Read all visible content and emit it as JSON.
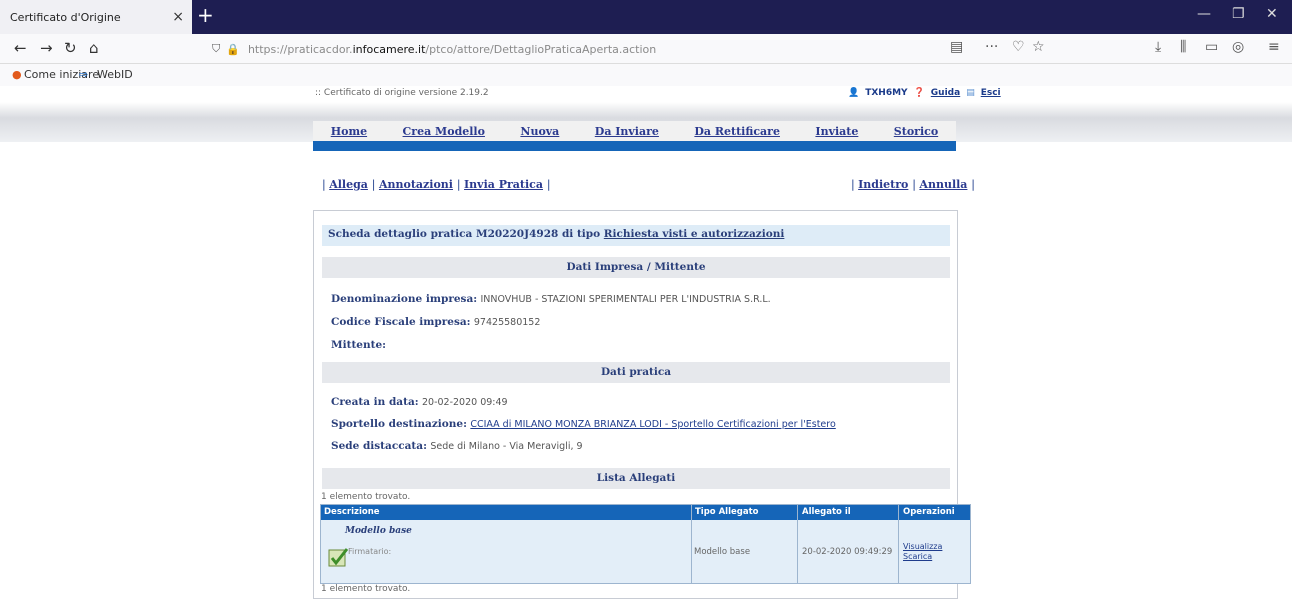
{
  "browser": {
    "tab_title": "Certificato d'Origine",
    "tab_close": "×",
    "new_tab": "+",
    "url_prefix": "https://praticacdor.",
    "url_domain": "infocamere.it",
    "url_path": "/ptco/attore/DettaglioPraticaAperta.action",
    "url_more": "···"
  },
  "bookmarks": [
    "Come iniziare",
    "WebID"
  ],
  "header": {
    "version": ":: Certificato di origine versione 2.19.2",
    "user": "TXH6MY",
    "guida": "Guida",
    "esci": "Esci"
  },
  "menu": [
    "Home",
    "Crea Modello",
    "Nuova",
    "Da Inviare",
    "Da Rettificare",
    "Inviate",
    "Storico"
  ],
  "actions_left": [
    "Allega",
    "Annotazioni",
    "Invia Pratica"
  ],
  "actions_right": [
    "Indietro",
    "Annulla"
  ],
  "scheda": {
    "prefix": "Scheda dettaglio pratica M20220J4928 di tipo",
    "tipo": "Richiesta visti e autorizzazioni"
  },
  "sections": {
    "impresa": "Dati Impresa / Mittente",
    "pratica": "Dati pratica",
    "allegati": "Lista Allegati"
  },
  "impresa": {
    "denominazione_label": "Denominazione impresa:",
    "denominazione_value": "INNOVHUB - STAZIONI SPERIMENTALI PER L'INDUSTRIA S.R.L.",
    "cf_label": "Codice Fiscale impresa:",
    "cf_value": "97425580152",
    "mittente_label": "Mittente:"
  },
  "pratica": {
    "creata_label": "Creata in data:",
    "creata_value": "20-02-2020 09:49",
    "sportello_label": "Sportello destinazione:",
    "sportello_value": "CCIAA di MILANO MONZA BRIANZA LODI - Sportello Certificazioni per l'Estero",
    "sede_label": "Sede distaccata:",
    "sede_value": "Sede di Milano - Via Meravigli, 9"
  },
  "allegati": {
    "found_top": "1 elemento trovato.",
    "found_bottom": "1 elemento trovato.",
    "headers": [
      "Descrizione",
      "Tipo Allegato",
      "Allegato il",
      "Operazioni"
    ],
    "row": {
      "title": "Modello base",
      "firmatario": "Firmatario:",
      "tipo": "Modello base",
      "data": "20-02-2020 09:49:29",
      "op1": "Visualizza",
      "op2": "Scarica"
    }
  },
  "colors": {
    "tabbar": "#1e1e52",
    "menu_bar": "#1565b8",
    "link": "#2b3a8f",
    "section_bg": "#e6e8ec",
    "scheda_bg": "#deecf7"
  }
}
